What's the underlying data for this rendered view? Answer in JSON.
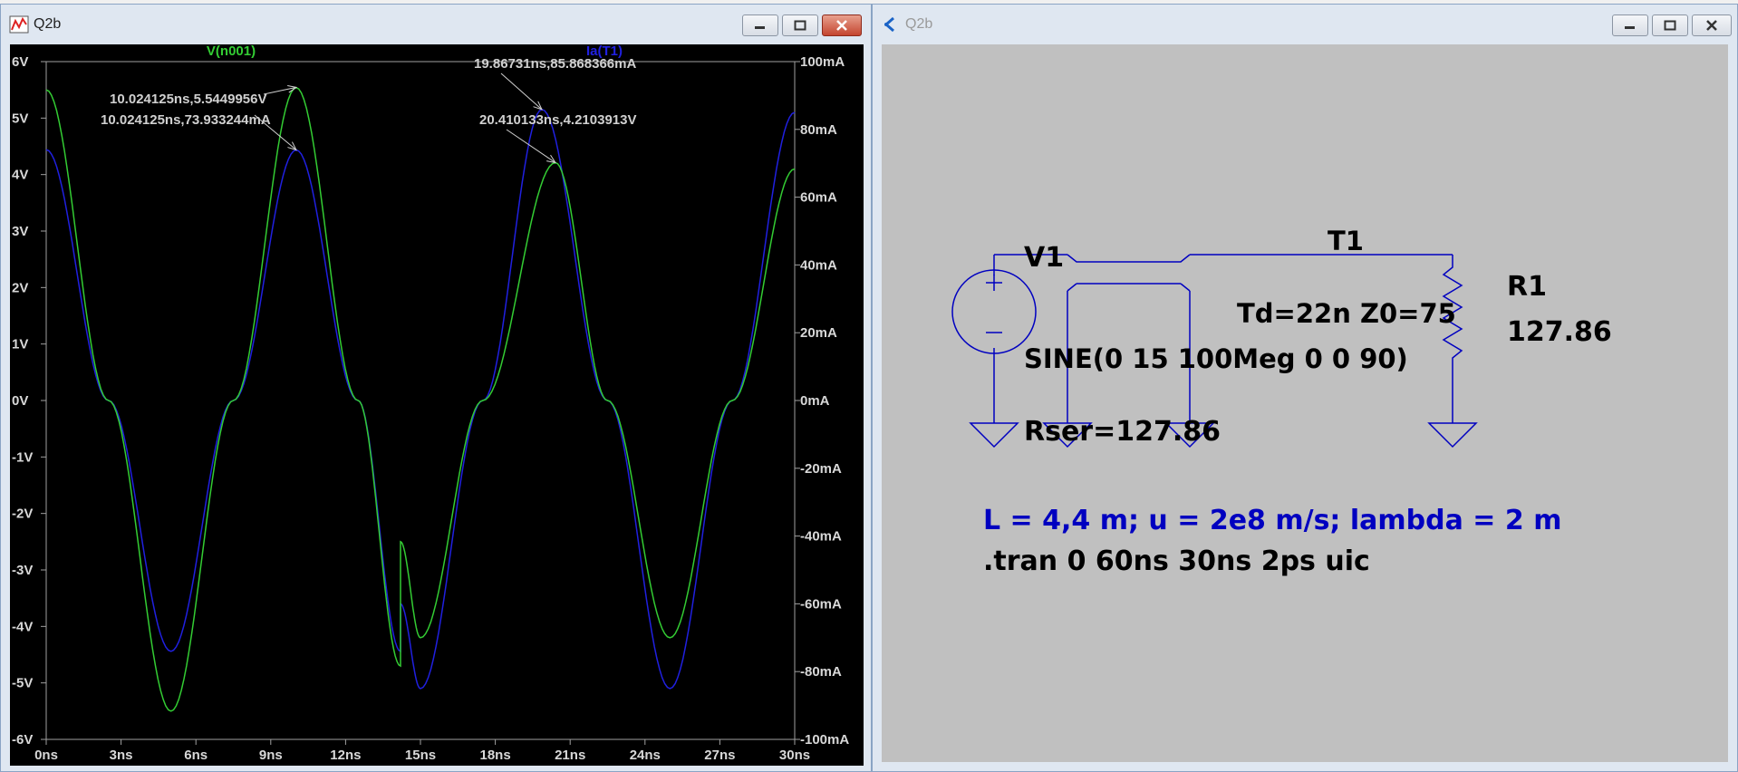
{
  "waveform_window": {
    "title": "Q2b",
    "traces": [
      {
        "label": "V(n001)",
        "color": "#33cc33"
      },
      {
        "label": "Ia(T1)",
        "color": "#2020e0"
      }
    ],
    "left_axis_ticks": [
      "6V",
      "5V",
      "4V",
      "3V",
      "2V",
      "1V",
      "0V",
      "-1V",
      "-2V",
      "-3V",
      "-4V",
      "-5V",
      "-6V"
    ],
    "right_axis_ticks": [
      "100mA",
      "80mA",
      "60mA",
      "40mA",
      "20mA",
      "0mA",
      "-20mA",
      "-40mA",
      "-60mA",
      "-80mA",
      "-100mA"
    ],
    "x_axis_ticks": [
      "0ns",
      "3ns",
      "6ns",
      "9ns",
      "12ns",
      "15ns",
      "18ns",
      "21ns",
      "24ns",
      "27ns",
      "30ns"
    ],
    "cursor_labels": [
      "10.024125ns,5.5449956V",
      "10.024125ns,73.933244mA",
      "19.86731ns,85.868366mA",
      "20.410133ns,4.2103913V"
    ]
  },
  "chart_data": {
    "type": "line",
    "xlabel": "",
    "ylabel": "",
    "xlim": [
      0,
      30
    ],
    "x_unit": "ns",
    "ylim_left": [
      -6,
      6
    ],
    "left_unit": "V",
    "ylim_right": [
      -100,
      100
    ],
    "right_unit": "mA",
    "grid": false,
    "series": [
      {
        "name": "V(n001)",
        "axis": "left",
        "x": [
          0,
          2.5,
          5,
          7.5,
          10.02,
          12.5,
          14.2,
          14.2,
          15,
          17.5,
          20.41,
          22.5,
          25,
          27.5,
          30
        ],
        "y": [
          5.5,
          0,
          -5.5,
          0,
          5.54,
          0,
          -4.7,
          -2.5,
          -4.2,
          0,
          4.21,
          0,
          -4.2,
          0,
          4.1
        ]
      },
      {
        "name": "Ia(T1)",
        "axis": "right",
        "x": [
          0,
          2.5,
          5,
          7.5,
          10.02,
          12.5,
          14.2,
          14.2,
          15,
          17.5,
          19.87,
          22.5,
          25,
          27.5,
          30
        ],
        "y": [
          74,
          0,
          -74,
          0,
          73.93,
          0,
          -74,
          -60,
          -85,
          0,
          85.87,
          0,
          -85,
          0,
          85
        ]
      }
    ],
    "annotations": [
      {
        "text": "10.024125ns,5.5449956V",
        "x": 10.024125,
        "y": 5.5449956,
        "axis": "left"
      },
      {
        "text": "10.024125ns,73.933244mA",
        "x": 10.024125,
        "y": 73.933244,
        "axis": "right"
      },
      {
        "text": "19.86731ns,85.868366mA",
        "x": 19.86731,
        "y": 85.868366,
        "axis": "right"
      },
      {
        "text": "20.410133ns,4.2103913V",
        "x": 20.410133,
        "y": 4.2103913,
        "axis": "left"
      }
    ]
  },
  "schematic_window": {
    "title": "Q2b",
    "source_name": "V1",
    "source_value": "SINE(0 15 100Meg 0 0 90)",
    "source_rser": "Rser=127.86",
    "tline_name": "T1",
    "tline_value": "Td=22n Z0=75",
    "resistor_name": "R1",
    "resistor_value": "127.86",
    "comment": "L = 4,4 m; u = 2e8 m/s; lambda = 2 m",
    "directive": ".tran 0 60ns 30ns 2ps uic",
    "colors": {
      "wire": "#0000c0",
      "comment": "#0000c0",
      "text": "#000000",
      "background": "#c0c0c0"
    }
  }
}
